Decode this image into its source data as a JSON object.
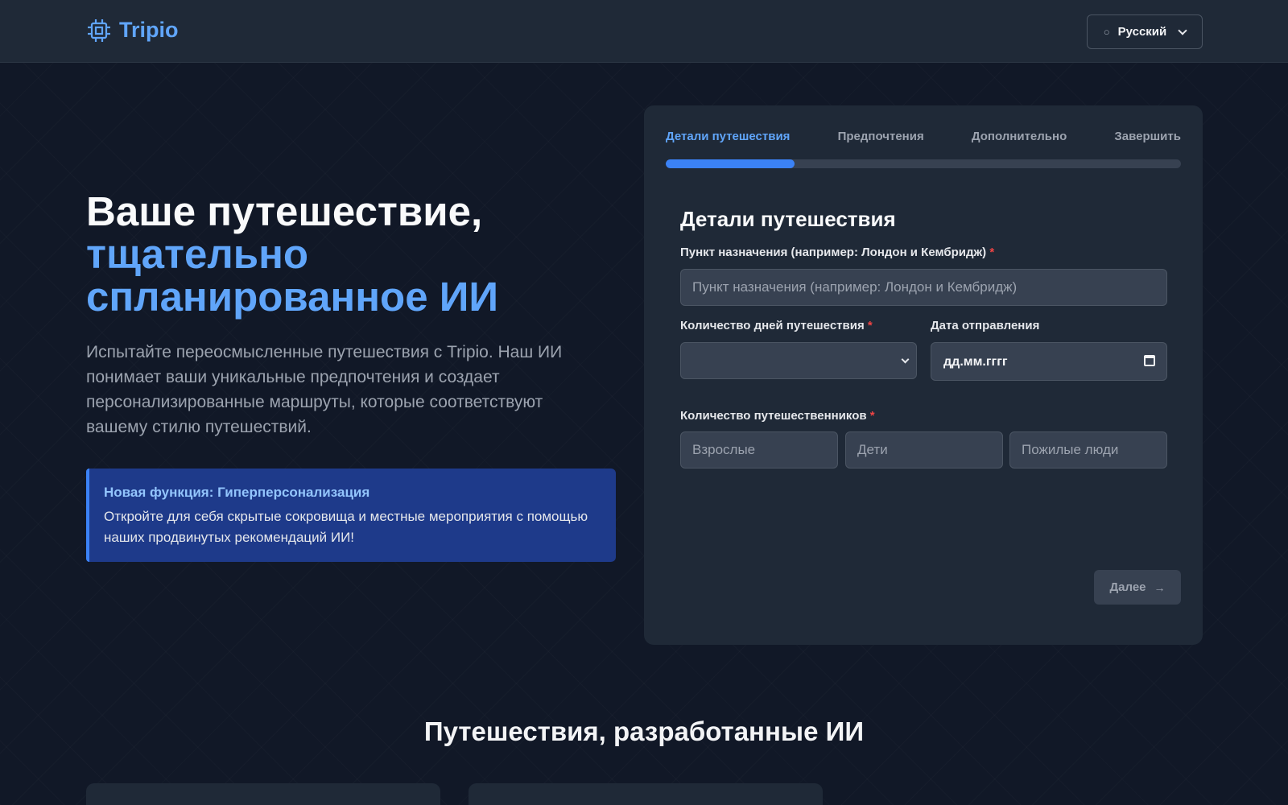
{
  "header": {
    "logo_text": "Tripio",
    "logo_icon": "cpu-chip-icon",
    "language_icon": "globe-icon",
    "language_label": "Русский"
  },
  "hero": {
    "title_line1": "Ваше путешествие,",
    "title_accent": "тщательно спланированное ИИ",
    "description": "Испытайте переосмысленные путешествия с Tripio. Наш ИИ понимает ваши уникальные предпочтения и создает персонализированные маршруты, которые соответствуют вашему стилю путешествий.",
    "feature_title": "Новая функция: Гиперперсонализация",
    "feature_text": "Откройте для себя скрытые сокровища и местные мероприятия с помощью наших продвинутых рекомендаций ИИ!"
  },
  "wizard": {
    "steps": [
      "Детали путешествия",
      "Предпочтения",
      "Дополнительно",
      "Завершить"
    ],
    "active_step": 0,
    "progress": 0.25,
    "form_title": "Детали путешествия",
    "destination_label": "Пункт назначения (например: Лондон и Кембридж)",
    "destination_placeholder": "Пункт назначения (например: Лондон и Кембридж)",
    "days_label": "Количество дней путешествия",
    "days_value": "",
    "departure_label": "Дата отправления",
    "departure_placeholder": "дд.мм.гггг",
    "travelers_label": "Количество путешественников",
    "adults_placeholder": "Взрослые",
    "children_placeholder": "Дети",
    "seniors_placeholder": "Пожилые люди",
    "required_mark": "*",
    "next_label": "Далее",
    "next_icon": "arrow-right-icon"
  },
  "section": {
    "title": "Путешествия, разработанные ИИ"
  },
  "colors": {
    "background": "#111827",
    "surface": "#1f2937",
    "accent": "#60a5fa",
    "progress": "#3b82f6",
    "feature_bg": "#1e3a8a",
    "required": "#ef4444"
  }
}
